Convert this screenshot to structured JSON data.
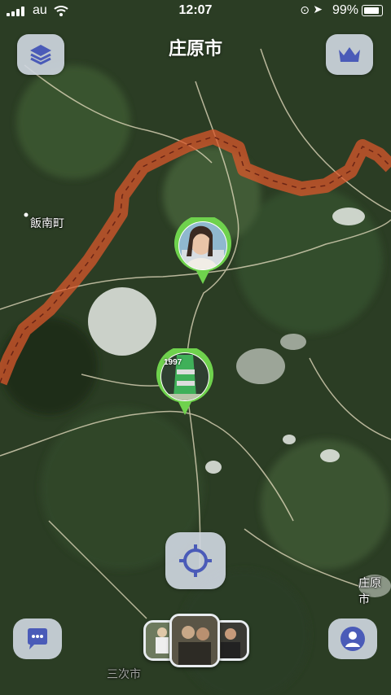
{
  "status_bar": {
    "carrier": "au",
    "time": "12:07",
    "battery": "99%"
  },
  "map": {
    "title": "庄原市",
    "places": [
      "飯南町",
      "庄原市",
      "三次市"
    ],
    "route_color": "#d9572b",
    "pin_color": "#6fd24d",
    "photo_pins": [
      {
        "caption": "1997"
      }
    ]
  },
  "controls": {
    "layers": "layers-icon",
    "premium": "crown-icon",
    "locate": "crosshair-icon",
    "chat": "chat-bubble-icon",
    "profile": "person-icon"
  },
  "colors": {
    "button_bg": "#cdd5de",
    "icon": "#4a5bb8"
  }
}
